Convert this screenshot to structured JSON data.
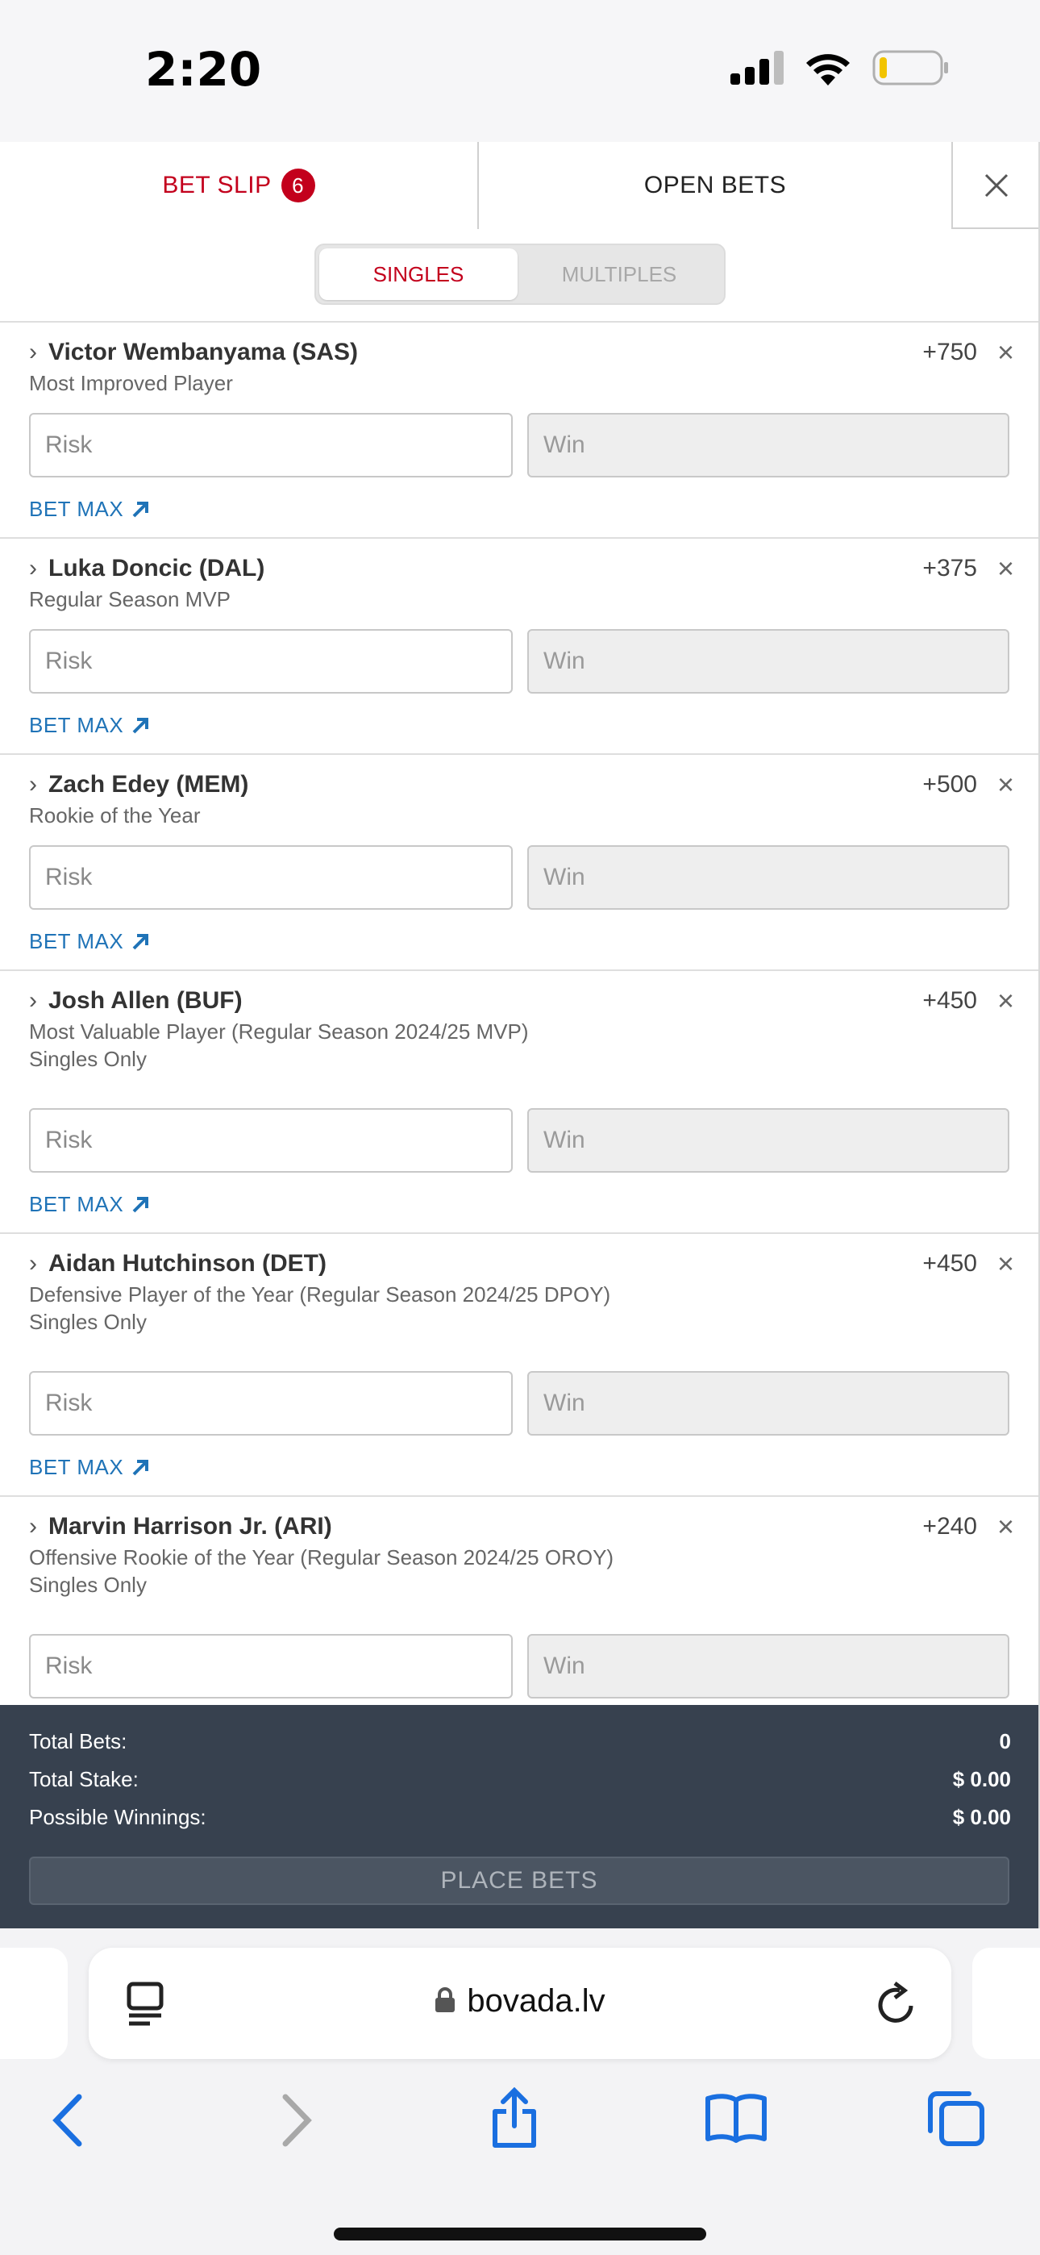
{
  "status": {
    "time": "2:20"
  },
  "tabs": {
    "betslip_label": "BET SLIP",
    "betslip_count": "6",
    "open_bets_label": "OPEN BETS",
    "close": "×"
  },
  "segment": {
    "singles": "SINGLES",
    "multiples": "MULTIPLES"
  },
  "common": {
    "risk_placeholder": "Risk",
    "win_placeholder": "Win",
    "bet_max": "BET MAX",
    "chevron": "›",
    "remove": "×"
  },
  "bets": [
    {
      "name": "Victor Wembanyama (SAS)",
      "market": "Most Improved Player",
      "note": "",
      "odds": "+750"
    },
    {
      "name": "Luka Doncic (DAL)",
      "market": "Regular Season MVP",
      "note": "",
      "odds": "+375"
    },
    {
      "name": "Zach Edey (MEM)",
      "market": "Rookie of the Year",
      "note": "",
      "odds": "+500"
    },
    {
      "name": "Josh Allen (BUF)",
      "market": "Most Valuable Player (Regular Season 2024/25 MVP)",
      "note": "Singles Only",
      "odds": "+450"
    },
    {
      "name": "Aidan Hutchinson (DET)",
      "market": "Defensive Player of the Year (Regular Season 2024/25 DPOY)",
      "note": "Singles Only",
      "odds": "+450"
    },
    {
      "name": "Marvin Harrison Jr. (ARI)",
      "market": "Offensive Rookie of the Year (Regular Season 2024/25 OROY)",
      "note": "Singles Only",
      "odds": "+240"
    }
  ],
  "summary": {
    "total_bets_label": "Total Bets:",
    "total_bets": "0",
    "total_stake_label": "Total Stake:",
    "total_stake": "$ 0.00",
    "winnings_label": "Possible Winnings:",
    "winnings": "$ 0.00",
    "place_label": "PLACE BETS"
  },
  "browser": {
    "url": "bovada.lv"
  },
  "icons": {
    "reader": "reader-mode-icon",
    "lock": "lock-icon",
    "reload": "reload-icon",
    "back": "back-icon",
    "forward": "forward-icon",
    "share": "share-icon",
    "bookmarks": "bookmarks-icon",
    "tabs": "tabs-icon"
  },
  "colors": {
    "accent_red": "#c3001c",
    "link_blue": "#1f73b7",
    "summary_bg": "#37414f",
    "ios_blue": "#1a6fe0"
  }
}
